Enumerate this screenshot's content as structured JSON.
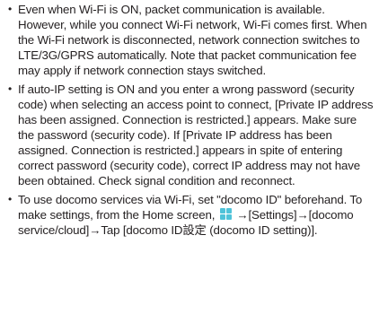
{
  "notes": [
    {
      "bullet": "•",
      "text": "Even when Wi-Fi is ON, packet communication is available. However, while you connect Wi-Fi network, Wi-Fi comes first. When the Wi-Fi network is disconnected, network connection switches to LTE/3G/GPRS automatically. Note that packet communication fee may apply if network connection stays switched."
    },
    {
      "bullet": "•",
      "text": "If auto-IP setting is ON and you enter a wrong password (security code) when selecting an access point to connect, [Private IP address has been assigned. Connection is restricted.] appears. Make sure the password (security code). If [Private IP address has been assigned. Connection is restricted.] appears in spite of entering correct password (security code), correct IP address may not have been obtained. Check signal condition and reconnect."
    },
    {
      "bullet": "•",
      "text_before_icon": "To use docomo services via Wi-Fi, set \"docomo ID\" beforehand. To make settings, from the Home screen,",
      "icon": "apps-grid-icon",
      "text_after_icon": "→[Settings]→[docomo service/cloud]→Tap [docomo ID設定 (docomo ID setting)]."
    }
  ],
  "colors": {
    "text": "#231f20",
    "icon": "#4fc3d9"
  }
}
